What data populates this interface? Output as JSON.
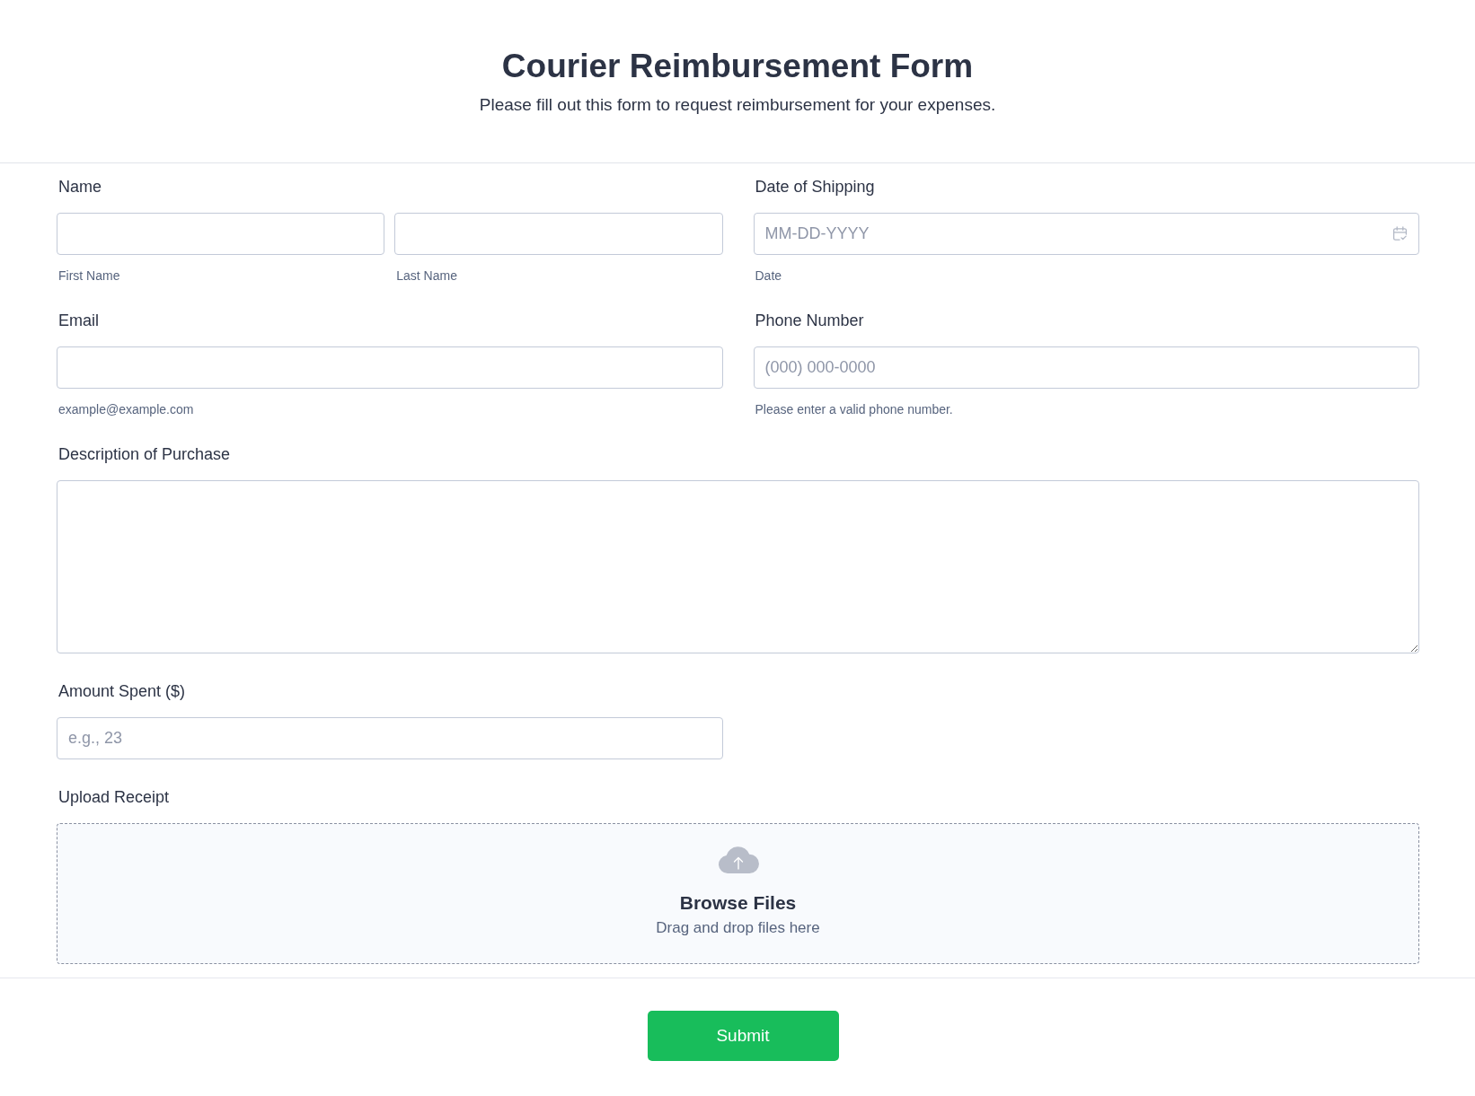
{
  "header": {
    "title": "Courier Reimbursement Form",
    "subtitle": "Please fill out this form to request reimbursement for your expenses."
  },
  "fields": [
    {
      "kind": "name",
      "label": "Name",
      "inputs": [
        {
          "sublabel": "First Name"
        },
        {
          "sublabel": "Last Name"
        }
      ]
    },
    {
      "kind": "date",
      "label": "Date of Shipping",
      "placeholder": "MM-DD-YYYY",
      "sublabel": "Date"
    },
    {
      "kind": "text",
      "label": "Email",
      "sublabel": "example@example.com"
    },
    {
      "kind": "text",
      "label": "Phone Number",
      "placeholder": "(000) 000-0000",
      "sublabel": "Please enter a valid phone number."
    },
    {
      "kind": "textarea",
      "label": "Description of Purchase"
    },
    {
      "kind": "text",
      "label": "Amount Spent ($)",
      "placeholder": "e.g., 23"
    },
    {
      "kind": "upload",
      "label": "Upload Receipt",
      "title": "Browse Files",
      "hint": "Drag and drop files here"
    }
  ],
  "submit": {
    "label": "Submit"
  }
}
